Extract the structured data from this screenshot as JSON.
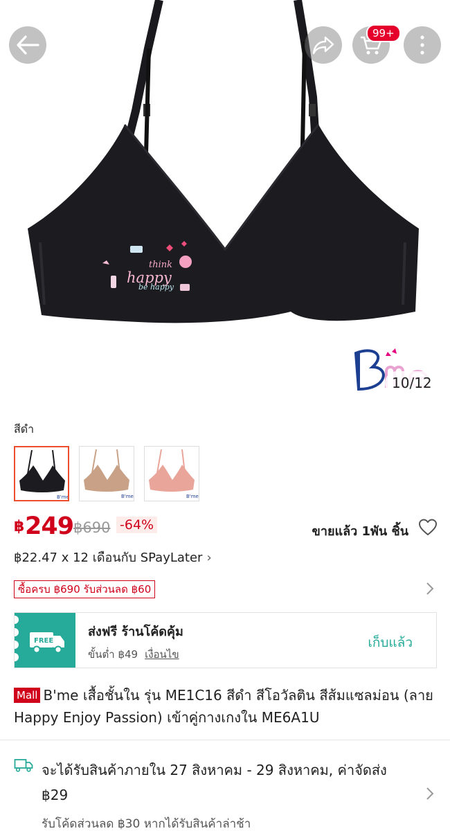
{
  "header": {
    "back_icon": "arrow-left-icon",
    "share_icon": "share-icon",
    "cart_icon": "cart-icon",
    "cart_badge": "99+",
    "more_icon": "more-vertical-icon"
  },
  "gallery": {
    "counter": "10/12",
    "print_lines": [
      "think",
      "happy",
      "be happy"
    ]
  },
  "variant": {
    "selected_color": "สีดำ",
    "swatches": [
      {
        "color": "#1c1c20",
        "selected": true
      },
      {
        "color": "#c9a187",
        "selected": false
      },
      {
        "color": "#e9a59a",
        "selected": false
      }
    ]
  },
  "price": {
    "currency": "฿",
    "current": "249",
    "original": "฿690",
    "discount": "-64%",
    "sold": "ขายแล้ว 1พัน ชิ้น"
  },
  "installment": {
    "text": "฿22.47 x 12 เดือนกับ SPayLater",
    "chevron": "›"
  },
  "promo": {
    "tag": "ซื้อครบ ฿690 รับส่วนลด ฿60"
  },
  "voucher": {
    "badge": "FREE",
    "title": "ส่งฟรี ร้านโค้ดคุ้ม",
    "min_spend": "ขั้นต่ำ ฿49",
    "conditions": "เงื่อนไข",
    "claim": "เก็บแล้ว"
  },
  "product": {
    "mall_badge": "Mall",
    "title": "B'me เสื้อชั้นใน รุ่น ME1C16 สีดำ สีโอวัลติน สีส้มแซลม่อน (ลาย Happy Enjoy Passion) เข้าคู่กางเกงใน ME6A1U"
  },
  "shipping": {
    "text": "จะได้รับสินค้าภายใน 27 สิงหาคม - 29 สิงหาคม, ค่าจัดส่ง ฿29",
    "sub": "รับโค้ดส่วนลด ฿30 หากได้รับสินค้าล่าช้า"
  },
  "colors": {
    "accent": "#d0011b",
    "teal": "#26aa99",
    "selected_border": "#ee4d2d"
  }
}
